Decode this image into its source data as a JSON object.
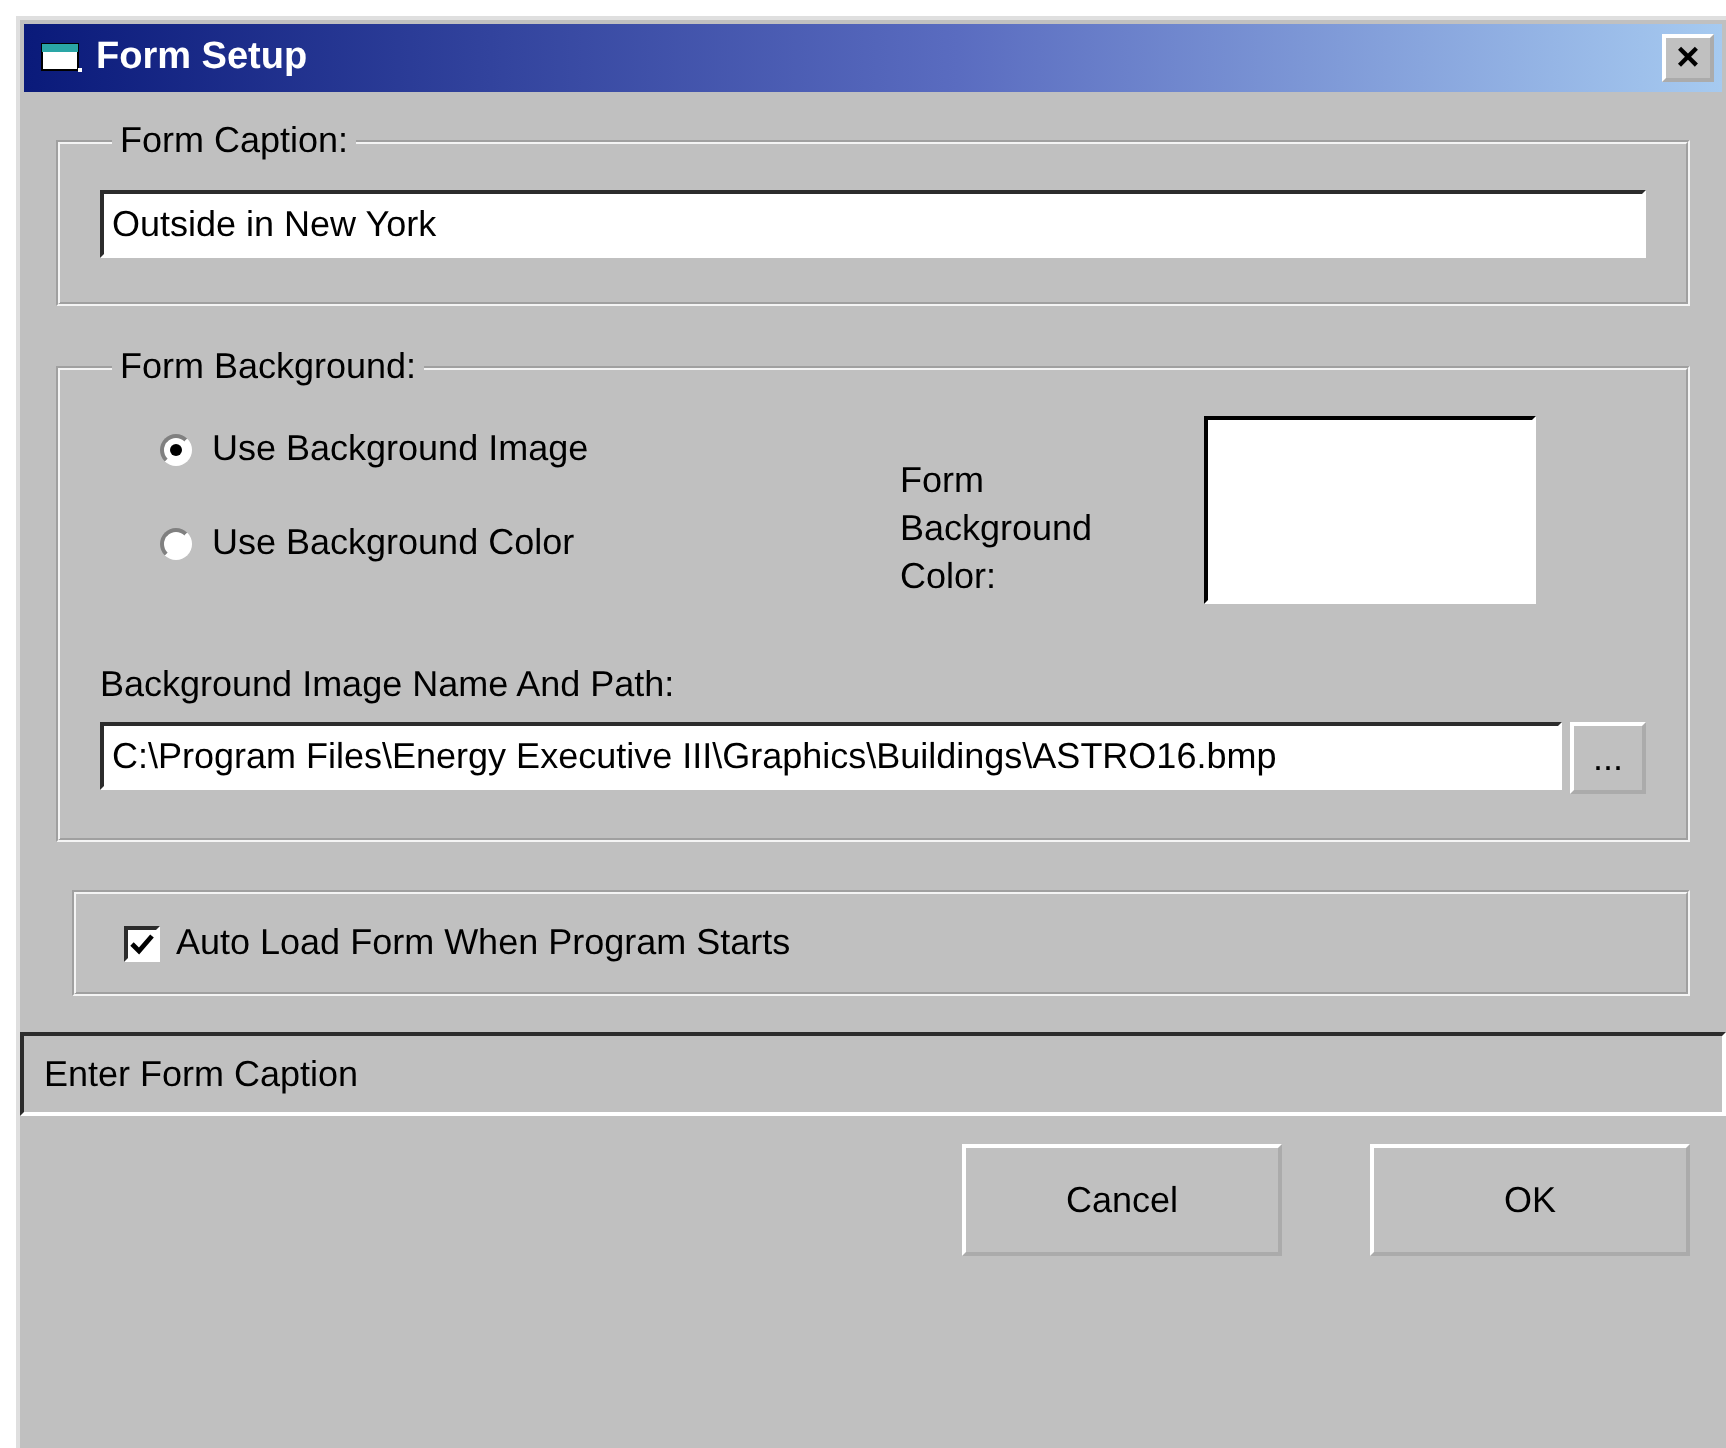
{
  "window": {
    "title": "Form Setup",
    "close": "×"
  },
  "caption_group": {
    "legend": "Form Caption:",
    "value": "Outside in New York"
  },
  "background_group": {
    "legend": "Form Background:",
    "options": [
      {
        "label": "Use Background Image",
        "selected": true
      },
      {
        "label": "Use Background Color",
        "selected": false
      }
    ],
    "color_label": "Form Background Color:",
    "path_label": "Background Image Name And Path:",
    "path_value": "C:\\Program Files\\Energy Executive III\\Graphics\\Buildings\\ASTRO16.bmp",
    "browse": "..."
  },
  "auto_load": {
    "label": "Auto Load Form When Program Starts",
    "checked": true
  },
  "status_bar": "Enter Form Caption",
  "buttons": [
    "Cancel",
    "OK"
  ]
}
